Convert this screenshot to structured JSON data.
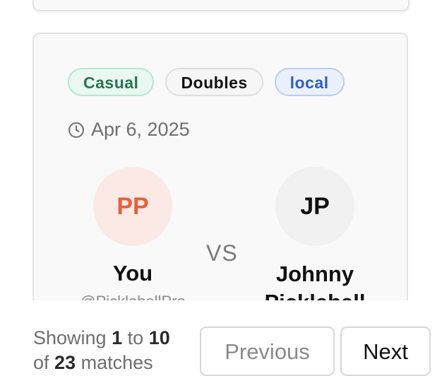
{
  "match_card": {
    "badges": [
      {
        "label": "Casual",
        "color": "#2a7451"
      },
      {
        "label": "Doubles",
        "color": "#111111"
      },
      {
        "label": "local",
        "color": "#2f5fc4"
      }
    ],
    "date": "Apr 6, 2025",
    "date_icon": "clock-icon",
    "player_left": {
      "initials": "PP",
      "name": "You",
      "handle": "@PickleballPro",
      "avatar_color": "#e4603f"
    },
    "vs_label": "VS",
    "player_right": {
      "initials": "JP",
      "name": "Johnny",
      "name_line2": "Pickleball"
    }
  },
  "pagination": {
    "showing_prefix": "Showing",
    "from": "1",
    "to_word": "to",
    "to": "10",
    "of_word": "of",
    "total": "23",
    "suffix": "matches",
    "previous_label": "Previous",
    "next_label": "Next"
  }
}
